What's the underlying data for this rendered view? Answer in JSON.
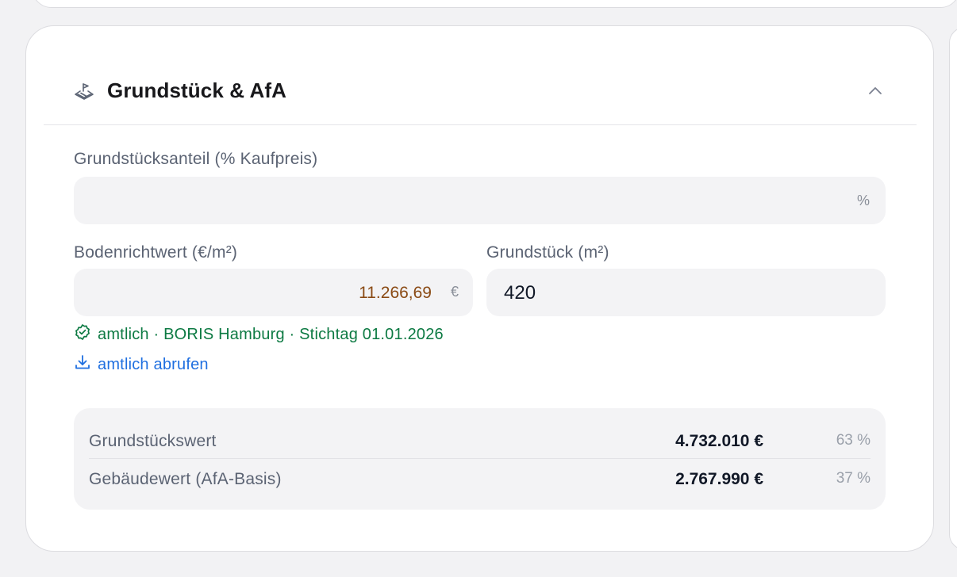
{
  "card": {
    "title": "Grundstück & AfA",
    "title_icon": "land-plot-icon",
    "collapse_icon": "chevron-up-icon"
  },
  "land_share": {
    "label": "Grundstücksanteil (% Kaufpreis)",
    "value": "",
    "suffix": "%"
  },
  "land_value_per_sqm": {
    "label": "Bodenrichtwert (€/m²)",
    "value": "11.266,69",
    "suffix": "€",
    "value_color": "#8a4a14"
  },
  "plot_size": {
    "label": "Grundstück (m²)",
    "value": "420"
  },
  "status": {
    "icon": "check-circle-icon",
    "text": "amtlich · BORIS Hamburg · Stichtag 01.01.2026",
    "color": "#0d7a43"
  },
  "fetch_link": {
    "icon": "download-icon",
    "label": "amtlich abrufen",
    "color": "#1f6fe0"
  },
  "summary": {
    "rows": [
      {
        "label": "Grundstückswert",
        "value": "4.732.010 €",
        "percent": "63 %"
      },
      {
        "label": "Gebäudewert (AfA-Basis)",
        "value": "2.767.990 €",
        "percent": "37 %"
      }
    ]
  }
}
